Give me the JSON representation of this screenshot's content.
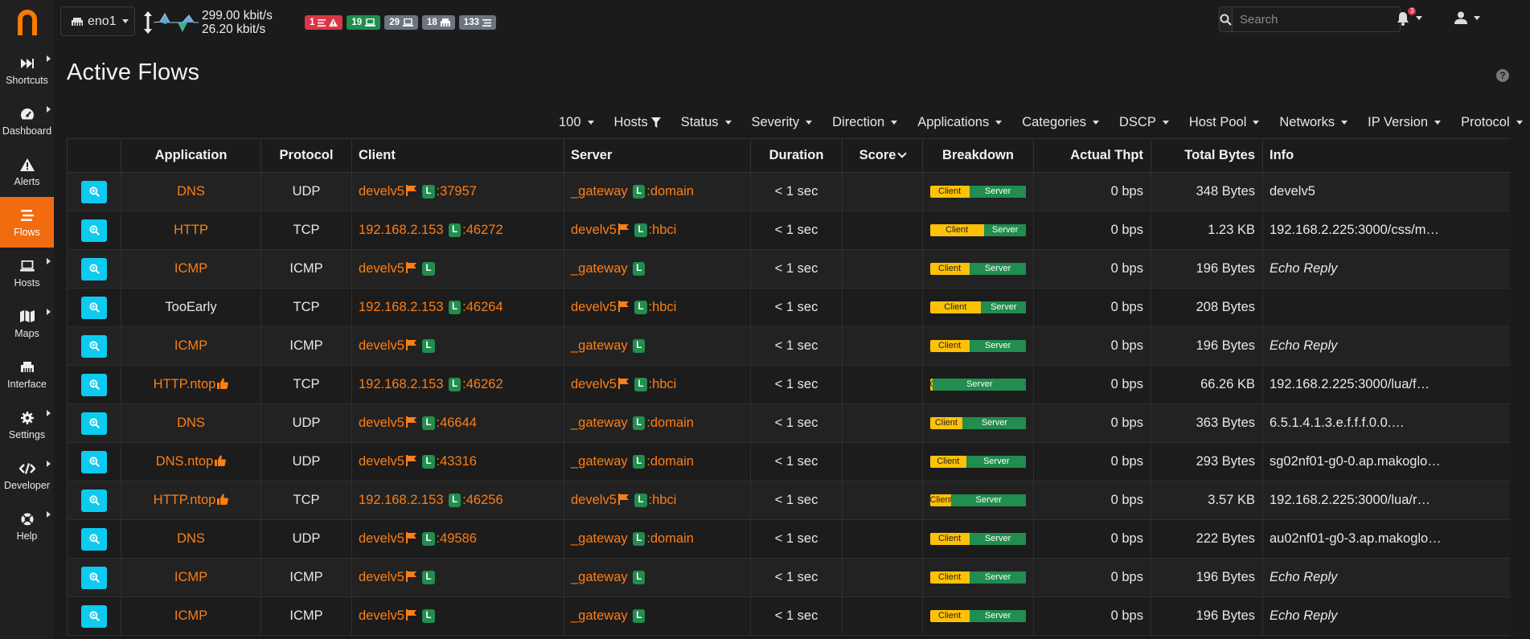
{
  "sidebar": {
    "items": [
      {
        "label": "Shortcuts",
        "icon": "forward-icon",
        "caret": true
      },
      {
        "label": "Dashboard",
        "icon": "gauge-icon",
        "caret": true
      },
      {
        "label": "Alerts",
        "icon": "warning-icon",
        "caret": false
      },
      {
        "label": "Flows",
        "icon": "stream-icon",
        "caret": false,
        "active": true
      },
      {
        "label": "Hosts",
        "icon": "laptop-icon",
        "caret": true
      },
      {
        "label": "Maps",
        "icon": "map-icon",
        "caret": true
      },
      {
        "label": "Interface",
        "icon": "ethernet-icon",
        "caret": false
      },
      {
        "label": "Settings",
        "icon": "cog-icon",
        "caret": true
      },
      {
        "label": "Developer",
        "icon": "code-icon",
        "caret": true
      },
      {
        "label": "Help",
        "icon": "life-ring-icon",
        "caret": true
      }
    ]
  },
  "topbar": {
    "interface": "eno1",
    "upload": "299.00 kbit/s",
    "download": "26.20 kbit/s",
    "badges": [
      {
        "count": "1",
        "kind": "alerts",
        "color": "#dc3545"
      },
      {
        "count": "19",
        "kind": "local-hosts",
        "color": "#218d4e"
      },
      {
        "count": "29",
        "kind": "hosts",
        "color": "#6c757d"
      },
      {
        "count": "18",
        "kind": "devices",
        "color": "#6c757d"
      },
      {
        "count": "133",
        "kind": "flows",
        "color": "#6c757d"
      }
    ],
    "search_placeholder": "Search",
    "notifications": "3"
  },
  "page": {
    "title": "Active Flows"
  },
  "filters": [
    "100",
    "Hosts",
    "Status",
    "Severity",
    "Direction",
    "Applications",
    "Categories",
    "DSCP",
    "Host Pool",
    "Networks",
    "IP Version",
    "Protocol"
  ],
  "table": {
    "headers": [
      "",
      "Application",
      "Protocol",
      "Client",
      "Server",
      "Duration",
      "Score",
      "Breakdown",
      "Actual Thpt",
      "Total Bytes",
      "Info"
    ],
    "rows": [
      {
        "app": "DNS",
        "app_link": true,
        "thumb": false,
        "proto": "UDP",
        "client": "develv5",
        "client_flag": true,
        "client_port": ":37957",
        "server": "_gateway",
        "server_flag": false,
        "server_port": ":domain",
        "duration": "< 1 sec",
        "score": "",
        "client_pct": 41,
        "thpt": "0 bps",
        "bytes": "348 Bytes",
        "info": "develv5",
        "info_italic": false
      },
      {
        "app": "HTTP",
        "app_link": true,
        "thumb": false,
        "proto": "TCP",
        "client": "192.168.2.153",
        "client_flag": false,
        "client_port": ":46272",
        "server": "develv5",
        "server_flag": true,
        "server_port": ":hbci",
        "duration": "< 1 sec",
        "score": "",
        "client_pct": 56,
        "thpt": "0 bps",
        "bytes": "1.23 KB",
        "info": "192.168.2.225:3000/css/m…",
        "info_italic": false
      },
      {
        "app": "ICMP",
        "app_link": true,
        "thumb": false,
        "proto": "ICMP",
        "client": "develv5",
        "client_flag": true,
        "client_port": "",
        "server": "_gateway",
        "server_flag": false,
        "server_port": "",
        "duration": "< 1 sec",
        "score": "",
        "client_pct": 41,
        "thpt": "0 bps",
        "bytes": "196 Bytes",
        "info": "Echo Reply",
        "info_italic": true
      },
      {
        "app": "TooEarly",
        "app_link": false,
        "thumb": false,
        "proto": "TCP",
        "client": "192.168.2.153",
        "client_flag": false,
        "client_port": ":46264",
        "server": "develv5",
        "server_flag": true,
        "server_port": ":hbci",
        "duration": "< 1 sec",
        "score": "",
        "client_pct": 53,
        "thpt": "0 bps",
        "bytes": "208 Bytes",
        "info": "",
        "info_italic": false
      },
      {
        "app": "ICMP",
        "app_link": true,
        "thumb": false,
        "proto": "ICMP",
        "client": "develv5",
        "client_flag": true,
        "client_port": "",
        "server": "_gateway",
        "server_flag": false,
        "server_port": "",
        "duration": "< 1 sec",
        "score": "",
        "client_pct": 41,
        "thpt": "0 bps",
        "bytes": "196 Bytes",
        "info": "Echo Reply",
        "info_italic": true
      },
      {
        "app": "HTTP.ntop",
        "app_link": true,
        "thumb": true,
        "proto": "TCP",
        "client": "192.168.2.153",
        "client_flag": false,
        "client_port": ":46262",
        "server": "develv5",
        "server_flag": true,
        "server_port": ":hbci",
        "duration": "< 1 sec",
        "score": "",
        "client_pct": 3,
        "thpt": "0 bps",
        "bytes": "66.26 KB",
        "info": "192.168.2.225:3000/lua/f…",
        "info_italic": false
      },
      {
        "app": "DNS",
        "app_link": true,
        "thumb": false,
        "proto": "UDP",
        "client": "develv5",
        "client_flag": true,
        "client_port": ":46644",
        "server": "_gateway",
        "server_flag": false,
        "server_port": ":domain",
        "duration": "< 1 sec",
        "score": "",
        "client_pct": 34,
        "thpt": "0 bps",
        "bytes": "363 Bytes",
        "info": "6.5.1.4.1.3.e.f.f.f.0.0.…",
        "info_italic": false
      },
      {
        "app": "DNS.ntop",
        "app_link": true,
        "thumb": true,
        "proto": "UDP",
        "client": "develv5",
        "client_flag": true,
        "client_port": ":43316",
        "server": "_gateway",
        "server_flag": false,
        "server_port": ":domain",
        "duration": "< 1 sec",
        "score": "",
        "client_pct": 38,
        "thpt": "0 bps",
        "bytes": "293 Bytes",
        "info": "sg02nf01-g0-0.ap.makoglo…",
        "info_italic": false
      },
      {
        "app": "HTTP.ntop",
        "app_link": true,
        "thumb": true,
        "proto": "TCP",
        "client": "192.168.2.153",
        "client_flag": false,
        "client_port": ":46256",
        "server": "develv5",
        "server_flag": true,
        "server_port": ":hbci",
        "duration": "< 1 sec",
        "score": "",
        "client_pct": 22,
        "thpt": "0 bps",
        "bytes": "3.57 KB",
        "info": "192.168.2.225:3000/lua/r…",
        "info_italic": false
      },
      {
        "app": "DNS",
        "app_link": true,
        "thumb": false,
        "proto": "UDP",
        "client": "develv5",
        "client_flag": true,
        "client_port": ":49586",
        "server": "_gateway",
        "server_flag": false,
        "server_port": ":domain",
        "duration": "< 1 sec",
        "score": "",
        "client_pct": 41,
        "thpt": "0 bps",
        "bytes": "222 Bytes",
        "info": "au02nf01-g0-3.ap.makoglo…",
        "info_italic": false
      },
      {
        "app": "ICMP",
        "app_link": true,
        "thumb": false,
        "proto": "ICMP",
        "client": "develv5",
        "client_flag": true,
        "client_port": "",
        "server": "_gateway",
        "server_flag": false,
        "server_port": "",
        "duration": "< 1 sec",
        "score": "",
        "client_pct": 41,
        "thpt": "0 bps",
        "bytes": "196 Bytes",
        "info": "Echo Reply",
        "info_italic": true
      },
      {
        "app": "ICMP",
        "app_link": true,
        "thumb": false,
        "proto": "ICMP",
        "client": "develv5",
        "client_flag": true,
        "client_port": "",
        "server": "_gateway",
        "server_flag": false,
        "server_port": "",
        "duration": "< 1 sec",
        "score": "",
        "client_pct": 41,
        "thpt": "0 bps",
        "bytes": "196 Bytes",
        "info": "Echo Reply",
        "info_italic": true
      }
    ],
    "breakdown_labels": {
      "client": "Client",
      "server": "Server"
    },
    "local_badge": "L"
  },
  "colors": {
    "accent": "#f26b0f",
    "link": "#fd7e14",
    "local_badge": "#218d4e",
    "client_bar": "#ffc107",
    "server_bar": "#218d4e",
    "action_button": "#0dcaf0"
  }
}
